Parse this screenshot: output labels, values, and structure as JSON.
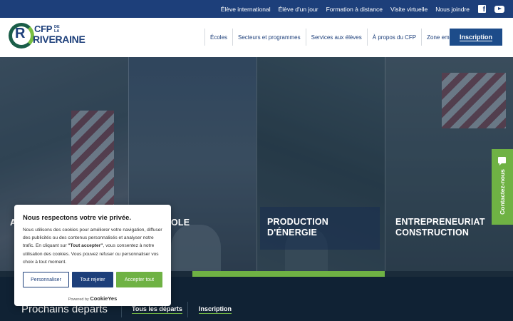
{
  "topbar": {
    "links": [
      "Élève international",
      "Élève d'un jour",
      "Formation à distance",
      "Visite virtuelle",
      "Nous joindre"
    ],
    "social_icons": [
      "facebook-icon",
      "youtube-icon"
    ]
  },
  "logo": {
    "letter": "R",
    "line1": "CFP",
    "small": "DE LA",
    "line2": "RIVERAINE"
  },
  "nav": {
    "items": [
      "Écoles",
      "Secteurs et programmes",
      "Services aux élèves",
      "À propos du CFP",
      "Zone emplois"
    ],
    "cta": "Inscription"
  },
  "hero": {
    "categories": [
      {
        "label": "A"
      },
      {
        "label": "OLE"
      },
      {
        "label": "PRODUCTION D'ÉNERGIE"
      },
      {
        "label": "ENTREPRENEURIAT CONSTRUCTION"
      }
    ]
  },
  "feedback": {
    "label": "Contactez-nous"
  },
  "departs": {
    "title": "Prochains départs",
    "all_link": "Tous les départs",
    "inscription_link": "Inscription"
  },
  "cookie": {
    "title": "Nous respectons votre vie privée.",
    "text_before": "Nous utilisons des cookies pour améliorer votre navigation, diffuser des publicités ou des contenus personnalisés et analyser notre trafic. En cliquant sur ",
    "text_bold": "\"Tout accepter\"",
    "text_after": ", vous consentez à notre utilisation des cookies. Vous pouvez refuser ou personnaliser vos choix à tout moment.",
    "btn_customize": "Personnaliser",
    "btn_reject": "Tout rejeter",
    "btn_accept": "Accepter tout",
    "powered_by": "Powered by",
    "brand": "CookieYes"
  },
  "colors": {
    "primary": "#1d3f7a",
    "accent_green": "#6fb244",
    "dark": "#102234"
  }
}
